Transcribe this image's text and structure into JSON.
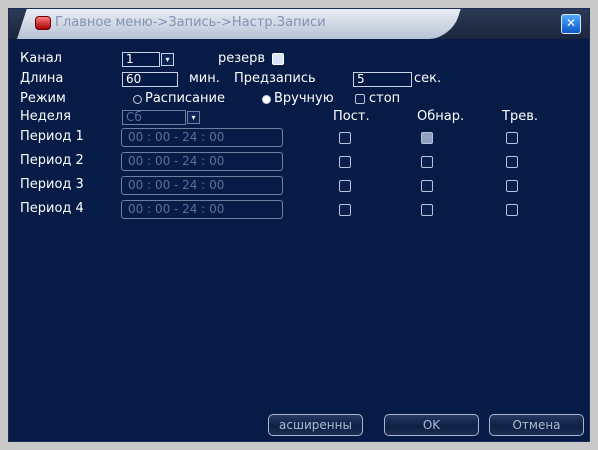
{
  "window": {
    "title": "Главное меню->Запись->Настр.Записи",
    "close_glyph": "✕"
  },
  "channel": {
    "label": "Канал",
    "value": "1",
    "dropdown_glyph": "▾"
  },
  "redundancy": {
    "label": "резерв",
    "checked": true
  },
  "length": {
    "label": "Длина",
    "value": "60",
    "unit": "мин."
  },
  "prerecord": {
    "label": "Предзапись",
    "value": "5",
    "unit": "сек."
  },
  "mode": {
    "label": "Режим",
    "options": [
      {
        "label": "Расписание",
        "selected": false
      },
      {
        "label": "Вручную",
        "selected": true
      }
    ],
    "stop": {
      "label": "стоп",
      "checked": false
    }
  },
  "week": {
    "label": "Неделя",
    "value": "Сб",
    "dropdown_glyph": "▾"
  },
  "columns": {
    "const": "Пост.",
    "detect": "Обнар.",
    "alarm": "Трев."
  },
  "periods": [
    {
      "label": "Период 1",
      "time": "00 : 00   -   24 : 00",
      "const": false,
      "detect": true,
      "alarm": false
    },
    {
      "label": "Период 2",
      "time": "00 : 00   -   24 : 00",
      "const": false,
      "detect": false,
      "alarm": false
    },
    {
      "label": "Период 3",
      "time": "00 : 00   -   24 : 00",
      "const": false,
      "detect": false,
      "alarm": false
    },
    {
      "label": "Период 4",
      "time": "00 : 00   -   24 : 00",
      "const": false,
      "detect": false,
      "alarm": false
    }
  ],
  "buttons": {
    "advanced": "асширенны",
    "ok": "OK",
    "cancel": "Отмена"
  }
}
